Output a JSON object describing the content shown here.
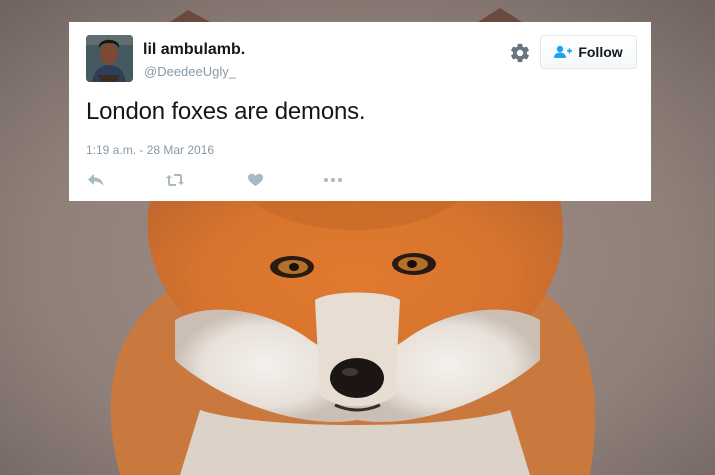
{
  "tweet": {
    "display_name": "lil ambulamb.",
    "handle": "@DeedeeUgly_",
    "text": "London foxes are demons.",
    "timestamp": "1:19 a.m. - 28 Mar 2016",
    "follow_label": "Follow"
  },
  "icons": {
    "settings": "gear-icon",
    "follow": "add-user-icon",
    "reply": "reply-icon",
    "retweet": "retweet-icon",
    "like": "heart-icon",
    "more": "more-icon"
  },
  "colors": {
    "icon_gray": "#aab8c2",
    "text": "#14171a",
    "meta": "#8899a6",
    "follow_icon": "#1da1f2"
  }
}
